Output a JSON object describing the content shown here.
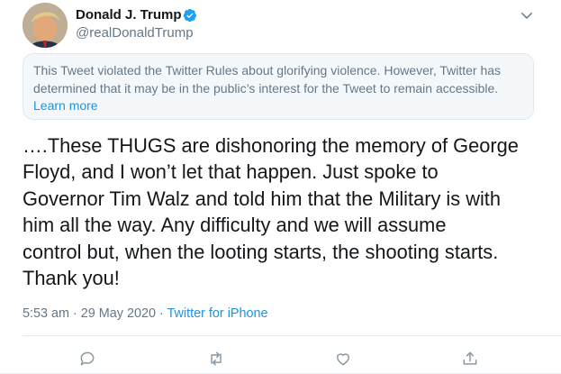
{
  "user": {
    "display_name": "Donald J. Trump",
    "handle": "@realDonaldTrump",
    "verified": true
  },
  "notice": {
    "text": "This Tweet violated the Twitter Rules about glorifying violence. However, Twitter has determined that it may be in the public’s interest for the Tweet to remain accessible.",
    "link_label": "Learn more"
  },
  "tweet": {
    "text": "….These THUGS are dishonoring the memory of George\nFloyd, and I won’t let that happen. Just spoke to\nGovernor Tim Walz and told him that the Military is with\nhim all the way. Any difficulty and we will assume\ncontrol but, when the looting starts, the shooting starts.\nThank you!",
    "time": "5:53 am",
    "date": "29 May 2020",
    "separator": "·",
    "source": "Twitter for iPhone"
  },
  "colors": {
    "accent": "#1b95e0",
    "secondary_text": "#657786",
    "notice_background": "#f5f8fa"
  },
  "icons": {
    "verified": "verified-badge-icon",
    "caret": "chevron-down-icon",
    "actions": [
      "reply-icon",
      "retweet-icon",
      "like-icon",
      "share-icon"
    ]
  }
}
